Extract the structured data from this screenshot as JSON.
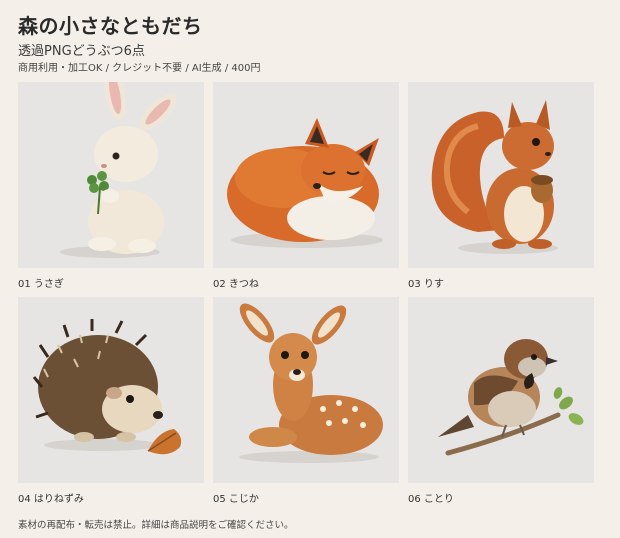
{
  "header": {
    "title": "森の小さなともだち",
    "subtitle": "透過PNGどうぶつ6点",
    "meta": "商用利用・加工OK / クレジット不要 / AI生成 / 400円"
  },
  "items": [
    {
      "caption": "01 うさぎ",
      "icon": "rabbit-illustration"
    },
    {
      "caption": "02 きつね",
      "icon": "fox-illustration"
    },
    {
      "caption": "03 りす",
      "icon": "squirrel-illustration"
    },
    {
      "caption": "04 はりねずみ",
      "icon": "hedgehog-illustration"
    },
    {
      "caption": "05 こじか",
      "icon": "fawn-illustration"
    },
    {
      "caption": "06 ことり",
      "icon": "sparrow-illustration"
    }
  ],
  "footer": {
    "notice": "素材の再配布・転売は禁止。詳細は商品説明をご確認ください。"
  },
  "colors": {
    "page_background": "#f4f0e9",
    "tile_background": "#e6e5e3"
  }
}
